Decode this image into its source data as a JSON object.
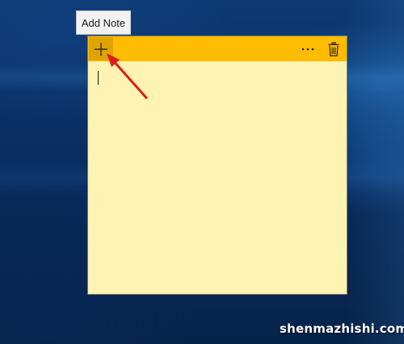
{
  "tooltip": {
    "text": "Add Note"
  },
  "sticky_note": {
    "header_color": "#ffbc00",
    "body_color": "#fef3b2",
    "add_button_highlight": "#e0a400",
    "menu_glyph": "···",
    "icons": {
      "add": "plus-icon",
      "menu": "more-dots-icon",
      "delete": "trash-icon"
    },
    "body_text": ""
  },
  "annotation": {
    "arrow_color": "#e11b1b"
  },
  "watermark": {
    "text": "shenmazhishi.com"
  }
}
